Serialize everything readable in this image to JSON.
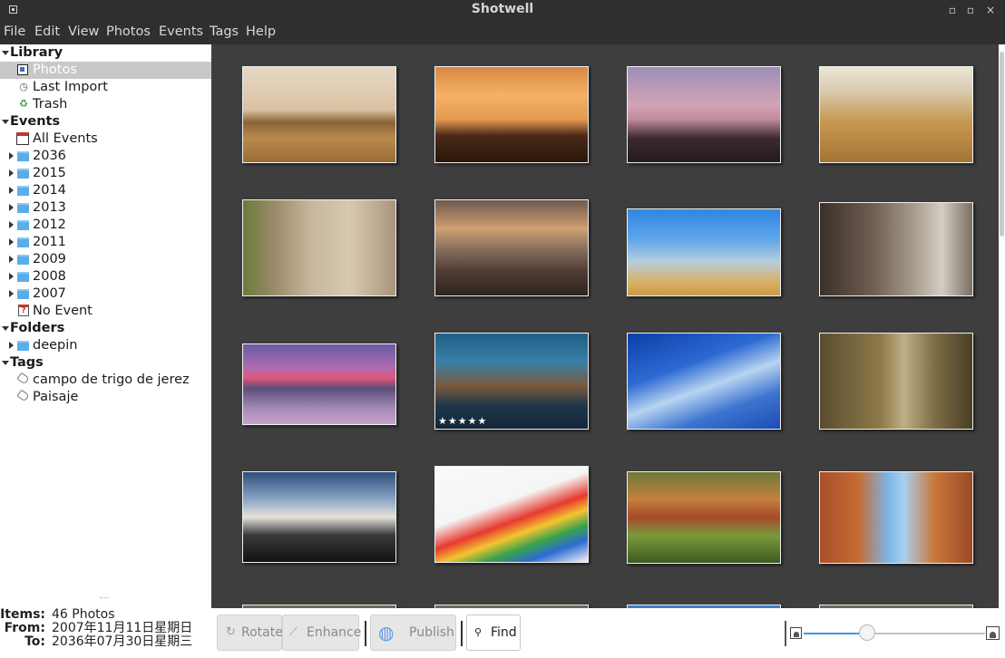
{
  "window": {
    "title": "Shotwell",
    "icon": "app-icon",
    "controls": [
      "minimize-icon",
      "maximize-icon",
      "close-icon"
    ]
  },
  "menu": [
    "File",
    "Edit",
    "View",
    "Photos",
    "Events",
    "Tags",
    "Help"
  ],
  "sidebar": {
    "library": {
      "header": "Library",
      "items": [
        {
          "label": "Photos",
          "icon": "photos-icon",
          "selected": true
        },
        {
          "label": "Last Import",
          "icon": "clock-icon"
        },
        {
          "label": "Trash",
          "icon": "trash-icon"
        }
      ]
    },
    "events": {
      "header": "Events",
      "all": "All Events",
      "years": [
        "2036",
        "2015",
        "2014",
        "2013",
        "2012",
        "2011",
        "2009",
        "2008",
        "2007"
      ],
      "no_event": "No Event"
    },
    "folders": {
      "header": "Folders",
      "items": [
        "deepin"
      ]
    },
    "tags": {
      "header": "Tags",
      "items": [
        "campo de trigo de jerez",
        "Paisaje"
      ]
    }
  },
  "info": {
    "items_label": "Items:",
    "items_value": "46 Photos",
    "from_label": "From:",
    "from_value": "2007年11月11日星期日",
    "to_label": "To:",
    "to_value": "2036年07月30日星期三"
  },
  "photos": [
    {
      "name": "wheat-field-trees",
      "bg": "linear-gradient(180deg,#e7d8c4 0%,#d9c2a2 45%,#8a6436 58%,#b98a4f 75%,#9b6b35 100%)"
    },
    {
      "name": "orange-sunset-field",
      "bg": "linear-gradient(180deg,#d98845 0%,#f3b266 30%,#e59850 55%,#4a2a17 72%,#2b170c 100%)"
    },
    {
      "name": "pink-sky-trees",
      "bg": "linear-gradient(180deg,#9c8fb8 0%,#d2a3b4 40%,#c08a9b 55%,#3b2a2e 75%,#251b1e 100%)"
    },
    {
      "name": "wheat-closeup",
      "bg": "linear-gradient(180deg,#ece6d6 0%,#d8ccb0 25%,#c79b55 55%,#b78540 80%,#a37437 100%)"
    },
    {
      "name": "blue-window-wall",
      "bg": "linear-gradient(90deg,#6b7a3a 0%,#9a8a68 20%,#c8b79f 45%,#d9c8b0 70%,#a8957c 100%)"
    },
    {
      "name": "paper-boat",
      "bg": "linear-gradient(180deg,#6e5a50 0%,#d0a070 30%,#8a7260 50%,#4e3c34 75%,#2d241f 100%)"
    },
    {
      "name": "blue-bokeh",
      "bg": "linear-gradient(180deg,#2f86e0 0%,#5fa6ea 35%,#b5cde0 60%,#d8b066 85%,#c99a44 100%)"
    },
    {
      "name": "bicycle-street",
      "bg": "linear-gradient(90deg,#3b3029 0%,#6f5f52 35%,#a3978a 60%,#d4cdc4 80%,#7b6e62 100%)"
    },
    {
      "name": "purple-lake-sunset",
      "bg": "linear-gradient(180deg,#6a5ba1 0%,#b06bb0 30%,#e0567a 42%,#5a4f7a 55%,#a58ab6 80%,#c7a2c9 100%)"
    },
    {
      "name": "venice-canal-night",
      "bg": "linear-gradient(180deg,#1f5e86 0%,#3b7fa8 30%,#7a5a3a 55%,#20384a 75%,#13263a 100%)",
      "rating": "★★★★★"
    },
    {
      "name": "blue-sky-clouds",
      "bg": "linear-gradient(160deg,#0d3fa8 0%,#2c6ad2 35%,#b8d4f0 55%,#3d74d0 75%,#1c4cb4 100%)"
    },
    {
      "name": "white-blossom",
      "bg": "linear-gradient(90deg,#5c4d2e 0%,#8d7a4a 40%,#bfae86 55%,#7e6d45 75%,#4a3f26 100%)"
    },
    {
      "name": "cloudy-sunset-sea",
      "bg": "linear-gradient(180deg,#2e4f7d 0%,#8aa3c5 30%,#e7e3da 50%,#3a3a3e 70%,#121214 100%)"
    },
    {
      "name": "rainbow-pencils",
      "bg": "linear-gradient(160deg,#fafafa 0%,#f5f5f5 40%,#e63a2f 55%,#f4c430 65%,#3aa34a 75%,#2c6bd1 85%,#f4f4f4 100%)"
    },
    {
      "name": "colorful-terraces",
      "bg": "linear-gradient(180deg,#6d7a3c 0%,#c6803e 30%,#a54a2a 50%,#7a9a3a 70%,#3c5a22 100%)"
    },
    {
      "name": "red-rock-arch",
      "bg": "linear-gradient(90deg,#a9502a 0%,#c66b32 25%,#7bb6e6 45%,#a8d0ee 55%,#c9773b 75%,#9b4a24 100%)"
    }
  ],
  "toolbar": {
    "rotate": "Rotate",
    "enhance": "Enhance",
    "publish": "Publish",
    "find": "Find"
  },
  "zoom": {
    "value": 0.35
  }
}
